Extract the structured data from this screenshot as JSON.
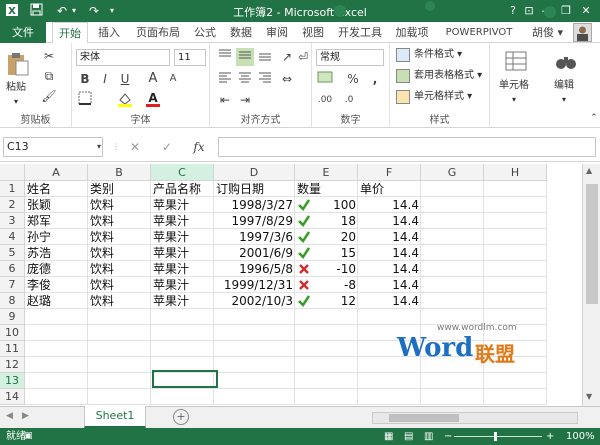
{
  "window": {
    "title": "工作簿2 - Microsoft Excel",
    "help": "?",
    "min": "—",
    "restore": "❐",
    "close": "✕",
    "restore_ribbon": "⊡"
  },
  "qat": {
    "save": "💾",
    "undo": "↶",
    "redo": "↷"
  },
  "tabs": {
    "file": "文件",
    "items": [
      "开始",
      "插入",
      "页面布局",
      "公式",
      "数据",
      "审阅",
      "视图",
      "开发工具",
      "加载项",
      "POWERPIVOT"
    ],
    "active": "开始",
    "user": "胡俊 ▾"
  },
  "ribbon": {
    "clipboard": {
      "label": "剪贴板",
      "paste": "粘贴"
    },
    "font": {
      "label": "字体",
      "name": "宋体",
      "size": "11",
      "bold": "B",
      "italic": "I",
      "underline": "U",
      "grow": "A",
      "shrink": "A"
    },
    "align": {
      "label": "对齐方式"
    },
    "number": {
      "label": "数字",
      "format": "常规",
      "percent": "%",
      "comma": ",",
      "inc": ".00",
      "dec": ".0"
    },
    "styles": {
      "label": "样式",
      "cond": "条件格式 ▾",
      "table": "套用表格格式 ▾",
      "cell": "单元格样式 ▾"
    },
    "cells": {
      "label": "单元格"
    },
    "edit": {
      "label": "编辑"
    }
  },
  "formula": {
    "namebox": "C13",
    "cancel": "✕",
    "enter": "✓",
    "fx": "fx",
    "value": ""
  },
  "columns": [
    "A",
    "B",
    "C",
    "D",
    "E",
    "F",
    "G",
    "H"
  ],
  "rows": [
    "1",
    "2",
    "3",
    "4",
    "5",
    "6",
    "7",
    "8",
    "9",
    "10",
    "11",
    "12",
    "13",
    "14"
  ],
  "table": {
    "header": [
      "姓名",
      "类别",
      "产品名称",
      "订购日期",
      "数量",
      "单价"
    ],
    "data": [
      [
        "张颖",
        "饮料",
        "苹果汁",
        "1998/3/27",
        "ok",
        "100",
        "14.4"
      ],
      [
        "郑军",
        "饮料",
        "苹果汁",
        "1997/8/29",
        "ok",
        "18",
        "14.4"
      ],
      [
        "孙宁",
        "饮料",
        "苹果汁",
        "1997/3/6",
        "ok",
        "20",
        "14.4"
      ],
      [
        "苏浩",
        "饮料",
        "苹果汁",
        "2001/6/9",
        "ok",
        "15",
        "14.4"
      ],
      [
        "庞德",
        "饮料",
        "苹果汁",
        "1996/5/8",
        "bad",
        "-10",
        "14.4"
      ],
      [
        "李俊",
        "饮料",
        "苹果汁",
        "1999/12/31",
        "bad",
        "-8",
        "14.4"
      ],
      [
        "赵璐",
        "饮料",
        "苹果汁",
        "2002/10/3",
        "ok",
        "12",
        "14.4"
      ]
    ]
  },
  "sheets": {
    "tabs": [
      "Sheet1"
    ],
    "add": "+"
  },
  "status": {
    "ready": "就绪",
    "zoom": "100%",
    "minus": "−",
    "plus": "+"
  },
  "watermark": {
    "url": "www.wordlm.com",
    "brand_w": "Word",
    "brand_cn": "联盟"
  },
  "colors": {
    "excel_green": "#217346",
    "ok": "#3a9a2a",
    "bad": "#d03030"
  }
}
